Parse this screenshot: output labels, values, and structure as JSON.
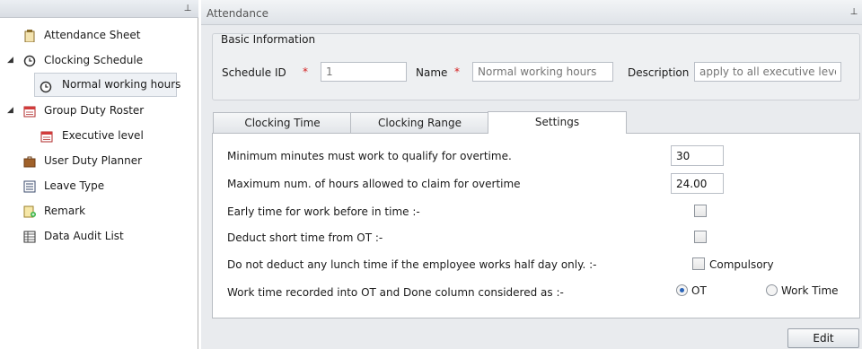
{
  "left_panel": {
    "tree": [
      {
        "label": "Attendance Sheet",
        "icon": "clipboard-icon"
      },
      {
        "label": "Clocking Schedule",
        "icon": "clock-icon",
        "expanded": true,
        "children": [
          {
            "label": "Normal working hours",
            "icon": "clock-icon",
            "selected": true
          }
        ]
      },
      {
        "label": "Group Duty Roster",
        "icon": "calendar-icon",
        "expanded": true,
        "children": [
          {
            "label": "Executive level",
            "icon": "calendar-icon"
          }
        ]
      },
      {
        "label": "User Duty Planner",
        "icon": "briefcase-icon"
      },
      {
        "label": "Leave Type",
        "icon": "list-icon"
      },
      {
        "label": "Remark",
        "icon": "note-add-icon"
      },
      {
        "label": "Data Audit List",
        "icon": "table-icon"
      }
    ]
  },
  "main": {
    "title": "Attendance",
    "basic_info": {
      "group_title": "Basic Information",
      "schedule_id_label": "Schedule ID",
      "schedule_id_placeholder": "1",
      "name_label": "Name",
      "name_placeholder": "Normal working hours",
      "description_label": "Description",
      "description_placeholder": "apply to all executive levels",
      "required_mark": "*"
    },
    "tabs": [
      {
        "label": "Clocking Time",
        "active": false
      },
      {
        "label": "Clocking Range",
        "active": false
      },
      {
        "label": "Settings",
        "active": true
      }
    ],
    "settings": {
      "min_minutes_label": "Minimum minutes must work to qualify for overtime.",
      "min_minutes_value": "30",
      "max_hours_label": "Maximum num. of hours allowed to claim for overtime",
      "max_hours_value": "24.00",
      "early_time_label": "Early time for work before in time :-",
      "early_time_checked": false,
      "deduct_short_label": "Deduct short time from OT :-",
      "deduct_short_checked": false,
      "no_deduct_lunch_label": "Do not deduct any lunch time if the employee works half day only. :-",
      "compulsory_label": "Compulsory",
      "compulsory_checked": false,
      "worktime_label": "Work time recorded into OT and Done column considered as :-",
      "options": [
        {
          "label": "OT",
          "selected": true
        },
        {
          "label": "Work Time",
          "selected": false
        }
      ]
    },
    "edit_button": "Edit"
  },
  "colors": {
    "accent": "#2a64b8",
    "required": "#d32020",
    "panel_bg": "#e9ebee"
  }
}
